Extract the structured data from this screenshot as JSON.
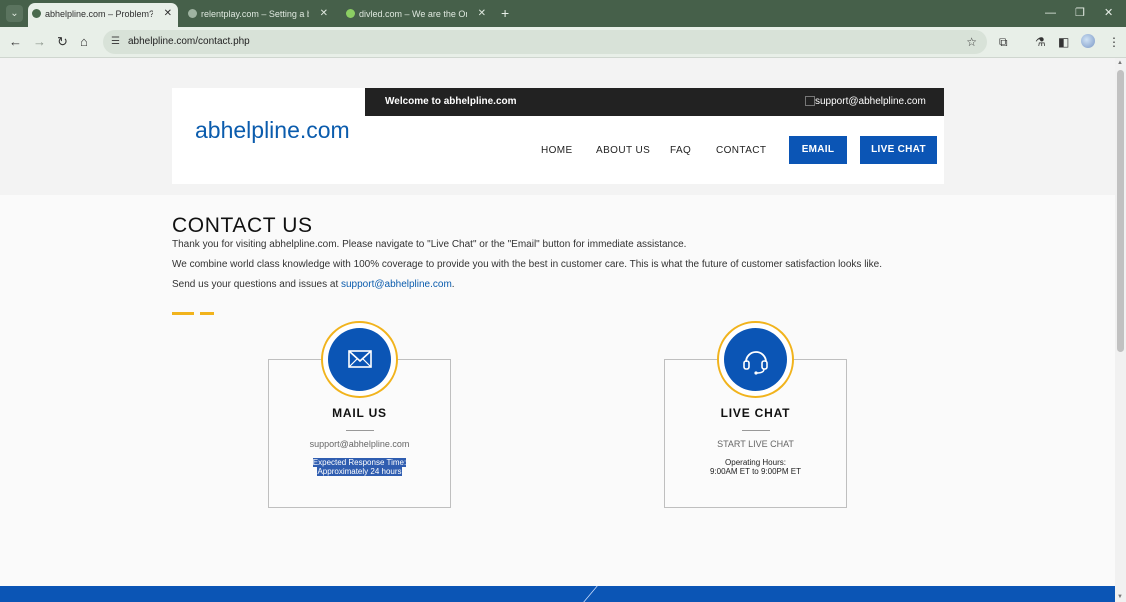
{
  "browser": {
    "tabs": [
      {
        "title": "abhelpline.com – Problem? We",
        "active": true,
        "favicon_color": "#4a6a4d"
      },
      {
        "title": "relentplay.com – Setting a bold",
        "active": false,
        "favicon_color": "#9fb3a1"
      },
      {
        "title": "divled.com – We are the Ones",
        "active": false,
        "favicon_color": "#8ccf63"
      }
    ],
    "tab_close_glyph": "✕",
    "new_tab_glyph": "+",
    "url": "abhelpline.com/contact.php"
  },
  "site": {
    "logo": "abhelpline.com",
    "welcome": "Welcome to abhelpline.com",
    "top_email": "support@abhelpline.com",
    "nav": {
      "home": "HOME",
      "about": "ABOUT US",
      "faq": "FAQ",
      "contact": "CONTACT",
      "email_btn": "EMAIL",
      "livechat_btn": "LIVE CHAT"
    }
  },
  "contact": {
    "title": "CONTACT US",
    "p1": "Thank you for visiting abhelpline.com. Please navigate to \"Live Chat\" or the \"Email\" button for immediate assistance.",
    "p2": "We combine world class knowledge with 100% coverage to provide you with the best in customer care. This is what the future of customer satisfaction looks like.",
    "p3_prefix": "Send us your questions and issues at ",
    "p3_link": "support@abhelpline.com",
    "p3_suffix": "."
  },
  "cards": {
    "mail": {
      "icon": "envelope-icon",
      "title": "MAIL US",
      "sub": "support@abhelpline.com",
      "line1": "Expected Response Time:",
      "line2": "Approximately 24 hours"
    },
    "chat": {
      "icon": "headset-icon",
      "title": "LIVE CHAT",
      "sub": "START LIVE CHAT",
      "line1": "Operating Hours:",
      "line2": "9:00AM ET to 9:00PM ET"
    }
  },
  "colors": {
    "brand_blue": "#0b55b5",
    "accent_gold": "#f1b31c",
    "topbar_dark": "#222222",
    "browser_frame": "#46604a"
  }
}
